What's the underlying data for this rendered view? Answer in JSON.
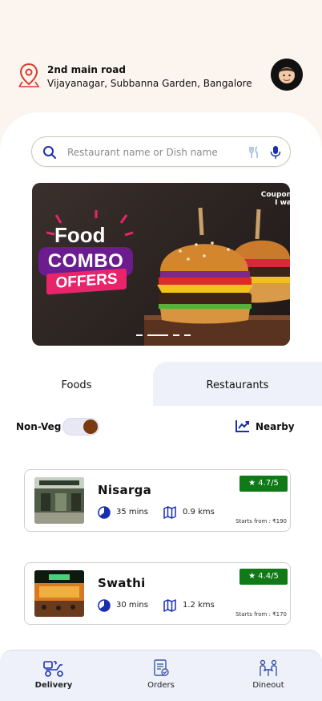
{
  "header": {
    "address_line1": "2nd main road",
    "address_line2": "Vijayanagar, Subbanna Garden, Bangalore",
    "location_icon": "map-pin-icon",
    "avatar_icon": "user-avatar"
  },
  "search": {
    "placeholder": "Restaurant name or Dish name",
    "icons": [
      "search-icon",
      "fork-knife-icon",
      "mic-icon"
    ]
  },
  "banner": {
    "line1": "Food",
    "line2": "COMBO",
    "line3": "OFFERS",
    "brand": "Coupon\nI wa",
    "slide_count": 5,
    "active_slide": 2
  },
  "tabs": {
    "foods": "Foods",
    "restaurants": "Restaurants",
    "active": "foods"
  },
  "filters": {
    "nonveg_label": "Non-Veg",
    "nonveg_on": true,
    "nearby_label": "Nearby"
  },
  "restaurants": [
    {
      "name": "Nisarga",
      "rating": "4.7/5",
      "time": "35 mins",
      "distance": "0.9 kms",
      "starts_from": "Starts from : ₹190"
    },
    {
      "name": "Swathi",
      "rating": "4.4/5",
      "time": "30 mins",
      "distance": "1.2 kms",
      "starts_from": "Starts from : ₹170"
    }
  ],
  "bottom_nav": [
    {
      "label": "Delivery",
      "icon": "delivery-scooter-icon",
      "active": true
    },
    {
      "label": "Orders",
      "icon": "orders-clipboard-icon",
      "active": false
    },
    {
      "label": "Dineout",
      "icon": "dineout-table-icon",
      "active": false
    }
  ],
  "colors": {
    "header_bg": "#fbf4ef",
    "accent_blue": "#1a2fb0",
    "rating_green": "#0f7a17",
    "location_red": "#d93a2a",
    "toggle_knob": "#7a3a10",
    "nav_bg": "#eef1fa"
  }
}
